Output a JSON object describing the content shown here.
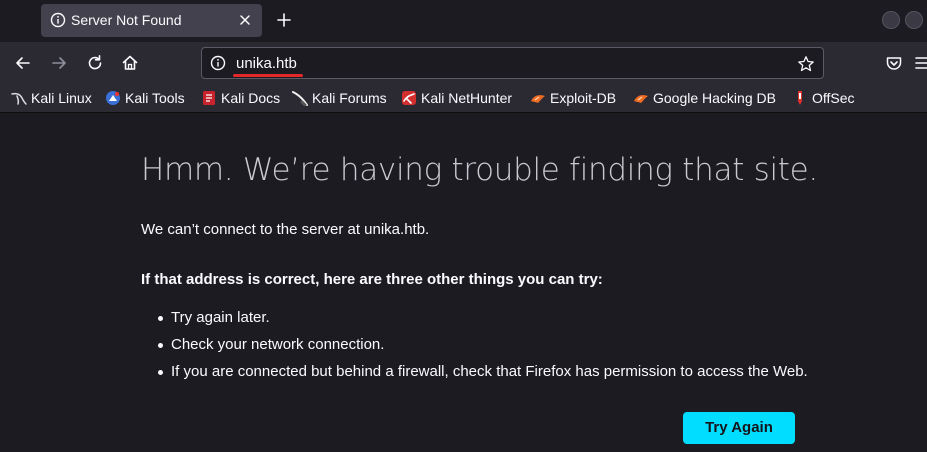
{
  "tab": {
    "title": "Server Not Found"
  },
  "urlbar": {
    "url": "unika.htb"
  },
  "bookmarks": [
    {
      "label": "Kali Linux",
      "icon": "kali-dragon-icon"
    },
    {
      "label": "Kali Tools",
      "icon": "kali-tools-icon"
    },
    {
      "label": "Kali Docs",
      "icon": "kali-docs-icon"
    },
    {
      "label": "Kali Forums",
      "icon": "kali-forums-icon"
    },
    {
      "label": "Kali NetHunter",
      "icon": "nethunter-icon"
    },
    {
      "label": "Exploit-DB",
      "icon": "exploit-db-icon"
    },
    {
      "label": "Google Hacking DB",
      "icon": "ghdb-icon"
    },
    {
      "label": "OffSec",
      "icon": "offsec-icon"
    }
  ],
  "error": {
    "title": "Hmm. We’re having trouble finding that site.",
    "description": "We can’t connect to the server at unika.htb.",
    "subhead": "If that address is correct, here are three other things you can try:",
    "suggestions": [
      "Try again later.",
      "Check your network connection.",
      "If you are connected but behind a firewall, check that Firefox has permission to access the Web."
    ],
    "button_label": "Try Again"
  },
  "colors": {
    "accent": "#00ddff",
    "underline": "#e22828",
    "page_bg": "#1c1b22",
    "toolbar_bg": "#2b2a33"
  }
}
